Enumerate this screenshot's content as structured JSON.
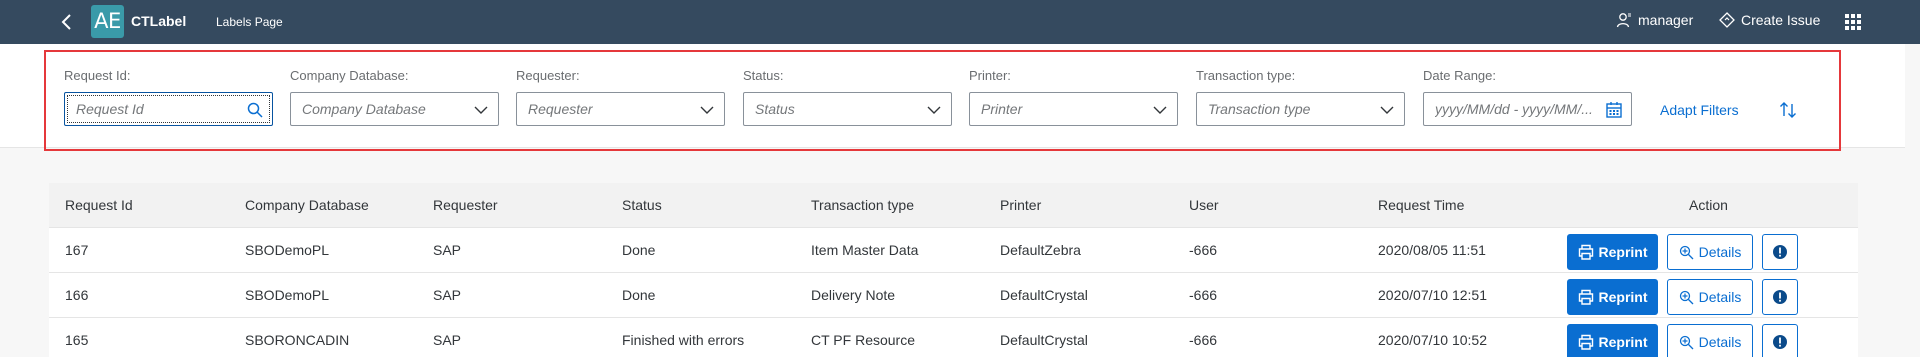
{
  "shell": {
    "logo_text": "AE",
    "app_name": "CTLabel",
    "subtitle": "Labels Page",
    "user_label": "manager",
    "create_issue_label": "Create Issue"
  },
  "filters": [
    {
      "label": "Request Id:",
      "placeholder": "Request Id",
      "icon": "search-icon"
    },
    {
      "label": "Company Database:",
      "placeholder": "Company Database",
      "icon": "chevron-down-icon"
    },
    {
      "label": "Requester:",
      "placeholder": "Requester",
      "icon": "chevron-down-icon"
    },
    {
      "label": "Status:",
      "placeholder": "Status",
      "icon": "chevron-down-icon"
    },
    {
      "label": "Printer:",
      "placeholder": "Printer",
      "icon": "chevron-down-icon"
    },
    {
      "label": "Transaction type:",
      "placeholder": "Transaction type",
      "icon": "chevron-down-icon"
    },
    {
      "label": "Date Range:",
      "placeholder": "yyyy/MM/dd - yyyy/MM/...",
      "icon": "calendar-icon"
    }
  ],
  "adapt_filters_label": "Adapt Filters",
  "table": {
    "headers": [
      "Request Id",
      "Company Database",
      "Requester",
      "Status",
      "Transaction type",
      "Printer",
      "User",
      "Request Time",
      "Action"
    ],
    "rows": [
      [
        "167",
        "SBODemoPL",
        "SAP",
        "Done",
        "Item Master Data",
        "DefaultZebra",
        "-666",
        "2020/08/05 11:51"
      ],
      [
        "166",
        "SBODemoPL",
        "SAP",
        "Done",
        "Delivery Note",
        "DefaultCrystal",
        "-666",
        "2020/07/10 12:51"
      ],
      [
        "165",
        "SBORONCADIN",
        "SAP",
        "Finished with errors",
        "CT PF Resource",
        "DefaultCrystal",
        "-666",
        "2020/07/10 10:52"
      ]
    ],
    "reprint_label": "Reprint",
    "details_label": "Details"
  },
  "colors": {
    "shell_bg": "#354a5f",
    "accent": "#0a6ed1",
    "highlight": "#e5383b"
  }
}
